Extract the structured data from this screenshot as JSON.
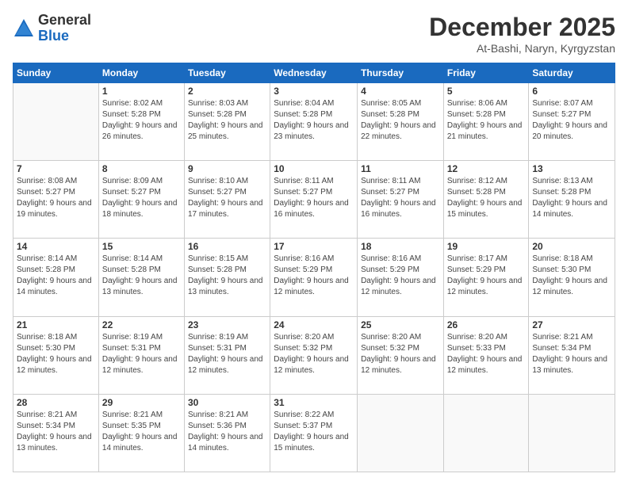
{
  "header": {
    "logo": {
      "general": "General",
      "blue": "Blue"
    },
    "title": "December 2025",
    "location": "At-Bashi, Naryn, Kyrgyzstan"
  },
  "calendar": {
    "weekdays": [
      "Sunday",
      "Monday",
      "Tuesday",
      "Wednesday",
      "Thursday",
      "Friday",
      "Saturday"
    ],
    "weeks": [
      [
        {
          "day": "",
          "sunrise": "",
          "sunset": "",
          "daylight": ""
        },
        {
          "day": "1",
          "sunrise": "Sunrise: 8:02 AM",
          "sunset": "Sunset: 5:28 PM",
          "daylight": "Daylight: 9 hours and 26 minutes."
        },
        {
          "day": "2",
          "sunrise": "Sunrise: 8:03 AM",
          "sunset": "Sunset: 5:28 PM",
          "daylight": "Daylight: 9 hours and 25 minutes."
        },
        {
          "day": "3",
          "sunrise": "Sunrise: 8:04 AM",
          "sunset": "Sunset: 5:28 PM",
          "daylight": "Daylight: 9 hours and 23 minutes."
        },
        {
          "day": "4",
          "sunrise": "Sunrise: 8:05 AM",
          "sunset": "Sunset: 5:28 PM",
          "daylight": "Daylight: 9 hours and 22 minutes."
        },
        {
          "day": "5",
          "sunrise": "Sunrise: 8:06 AM",
          "sunset": "Sunset: 5:28 PM",
          "daylight": "Daylight: 9 hours and 21 minutes."
        },
        {
          "day": "6",
          "sunrise": "Sunrise: 8:07 AM",
          "sunset": "Sunset: 5:27 PM",
          "daylight": "Daylight: 9 hours and 20 minutes."
        }
      ],
      [
        {
          "day": "7",
          "sunrise": "Sunrise: 8:08 AM",
          "sunset": "Sunset: 5:27 PM",
          "daylight": "Daylight: 9 hours and 19 minutes."
        },
        {
          "day": "8",
          "sunrise": "Sunrise: 8:09 AM",
          "sunset": "Sunset: 5:27 PM",
          "daylight": "Daylight: 9 hours and 18 minutes."
        },
        {
          "day": "9",
          "sunrise": "Sunrise: 8:10 AM",
          "sunset": "Sunset: 5:27 PM",
          "daylight": "Daylight: 9 hours and 17 minutes."
        },
        {
          "day": "10",
          "sunrise": "Sunrise: 8:11 AM",
          "sunset": "Sunset: 5:27 PM",
          "daylight": "Daylight: 9 hours and 16 minutes."
        },
        {
          "day": "11",
          "sunrise": "Sunrise: 8:11 AM",
          "sunset": "Sunset: 5:27 PM",
          "daylight": "Daylight: 9 hours and 16 minutes."
        },
        {
          "day": "12",
          "sunrise": "Sunrise: 8:12 AM",
          "sunset": "Sunset: 5:28 PM",
          "daylight": "Daylight: 9 hours and 15 minutes."
        },
        {
          "day": "13",
          "sunrise": "Sunrise: 8:13 AM",
          "sunset": "Sunset: 5:28 PM",
          "daylight": "Daylight: 9 hours and 14 minutes."
        }
      ],
      [
        {
          "day": "14",
          "sunrise": "Sunrise: 8:14 AM",
          "sunset": "Sunset: 5:28 PM",
          "daylight": "Daylight: 9 hours and 14 minutes."
        },
        {
          "day": "15",
          "sunrise": "Sunrise: 8:14 AM",
          "sunset": "Sunset: 5:28 PM",
          "daylight": "Daylight: 9 hours and 13 minutes."
        },
        {
          "day": "16",
          "sunrise": "Sunrise: 8:15 AM",
          "sunset": "Sunset: 5:28 PM",
          "daylight": "Daylight: 9 hours and 13 minutes."
        },
        {
          "day": "17",
          "sunrise": "Sunrise: 8:16 AM",
          "sunset": "Sunset: 5:29 PM",
          "daylight": "Daylight: 9 hours and 12 minutes."
        },
        {
          "day": "18",
          "sunrise": "Sunrise: 8:16 AM",
          "sunset": "Sunset: 5:29 PM",
          "daylight": "Daylight: 9 hours and 12 minutes."
        },
        {
          "day": "19",
          "sunrise": "Sunrise: 8:17 AM",
          "sunset": "Sunset: 5:29 PM",
          "daylight": "Daylight: 9 hours and 12 minutes."
        },
        {
          "day": "20",
          "sunrise": "Sunrise: 8:18 AM",
          "sunset": "Sunset: 5:30 PM",
          "daylight": "Daylight: 9 hours and 12 minutes."
        }
      ],
      [
        {
          "day": "21",
          "sunrise": "Sunrise: 8:18 AM",
          "sunset": "Sunset: 5:30 PM",
          "daylight": "Daylight: 9 hours and 12 minutes."
        },
        {
          "day": "22",
          "sunrise": "Sunrise: 8:19 AM",
          "sunset": "Sunset: 5:31 PM",
          "daylight": "Daylight: 9 hours and 12 minutes."
        },
        {
          "day": "23",
          "sunrise": "Sunrise: 8:19 AM",
          "sunset": "Sunset: 5:31 PM",
          "daylight": "Daylight: 9 hours and 12 minutes."
        },
        {
          "day": "24",
          "sunrise": "Sunrise: 8:20 AM",
          "sunset": "Sunset: 5:32 PM",
          "daylight": "Daylight: 9 hours and 12 minutes."
        },
        {
          "day": "25",
          "sunrise": "Sunrise: 8:20 AM",
          "sunset": "Sunset: 5:32 PM",
          "daylight": "Daylight: 9 hours and 12 minutes."
        },
        {
          "day": "26",
          "sunrise": "Sunrise: 8:20 AM",
          "sunset": "Sunset: 5:33 PM",
          "daylight": "Daylight: 9 hours and 12 minutes."
        },
        {
          "day": "27",
          "sunrise": "Sunrise: 8:21 AM",
          "sunset": "Sunset: 5:34 PM",
          "daylight": "Daylight: 9 hours and 13 minutes."
        }
      ],
      [
        {
          "day": "28",
          "sunrise": "Sunrise: 8:21 AM",
          "sunset": "Sunset: 5:34 PM",
          "daylight": "Daylight: 9 hours and 13 minutes."
        },
        {
          "day": "29",
          "sunrise": "Sunrise: 8:21 AM",
          "sunset": "Sunset: 5:35 PM",
          "daylight": "Daylight: 9 hours and 14 minutes."
        },
        {
          "day": "30",
          "sunrise": "Sunrise: 8:21 AM",
          "sunset": "Sunset: 5:36 PM",
          "daylight": "Daylight: 9 hours and 14 minutes."
        },
        {
          "day": "31",
          "sunrise": "Sunrise: 8:22 AM",
          "sunset": "Sunset: 5:37 PM",
          "daylight": "Daylight: 9 hours and 15 minutes."
        },
        {
          "day": "",
          "sunrise": "",
          "sunset": "",
          "daylight": ""
        },
        {
          "day": "",
          "sunrise": "",
          "sunset": "",
          "daylight": ""
        },
        {
          "day": "",
          "sunrise": "",
          "sunset": "",
          "daylight": ""
        }
      ]
    ]
  }
}
